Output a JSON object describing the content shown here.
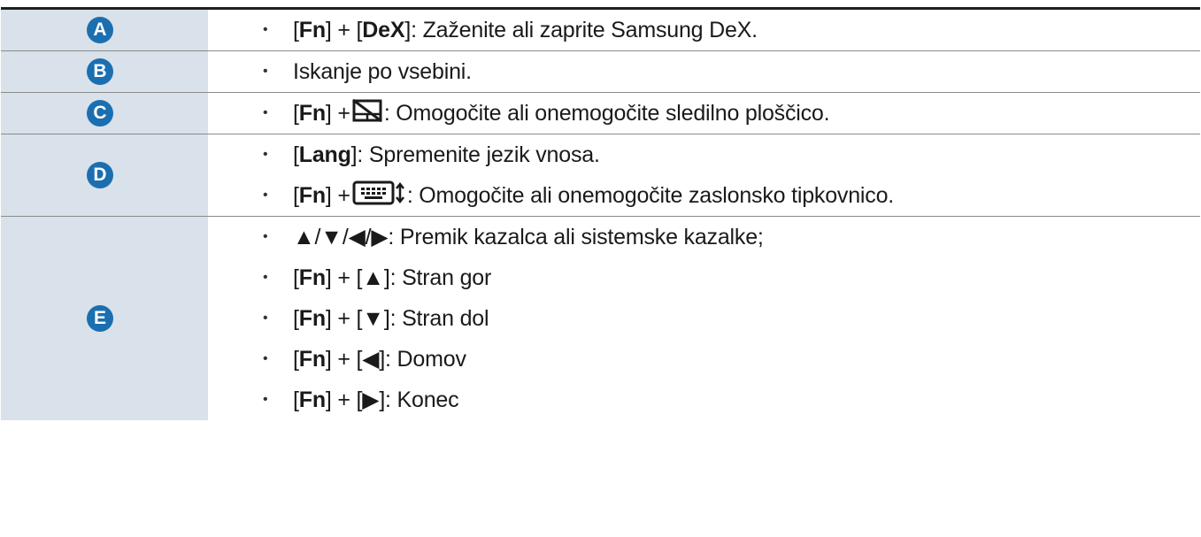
{
  "rows": [
    {
      "label": "A",
      "items": [
        {
          "parts": [
            "[",
            "Fn",
            "] + [",
            "DeX",
            "]: Zaženite ali zaprite Samsung DeX."
          ]
        }
      ]
    },
    {
      "label": "B",
      "items": [
        {
          "text": "Iskanje po vsebini."
        }
      ]
    },
    {
      "label": "C",
      "items": [
        {
          "pre": "[",
          "key": "Fn",
          "mid": "] + ",
          "icon": "touchpad-off-icon",
          "post": ": Omogočite ali onemogočite sledilno ploščico."
        }
      ]
    },
    {
      "label": "D",
      "items": [
        {
          "pre": "[",
          "key": "Lang",
          "post": "]: Spremenite jezik vnosa."
        },
        {
          "pre": "[",
          "key": "Fn",
          "mid": "] + ",
          "icon": "onscreen-keyboard-icon",
          "post": ": Omogočite ali onemogočite zaslonsko tipkovnico."
        }
      ]
    },
    {
      "label": "E",
      "items": [
        {
          "text": "▲/▼/◀/▶: Premik kazalca ali sistemske kazalke;"
        },
        {
          "pre": "[",
          "key": "Fn",
          "post": "] + [▲]: Stran gor"
        },
        {
          "pre": "[",
          "key": "Fn",
          "post": "] + [▼]: Stran dol"
        },
        {
          "pre": "[",
          "key": "Fn",
          "post": "] + [◀]: Domov"
        },
        {
          "pre": "[",
          "key": "Fn",
          "post": "] + [▶]: Konec"
        }
      ]
    }
  ],
  "bullet": "•"
}
